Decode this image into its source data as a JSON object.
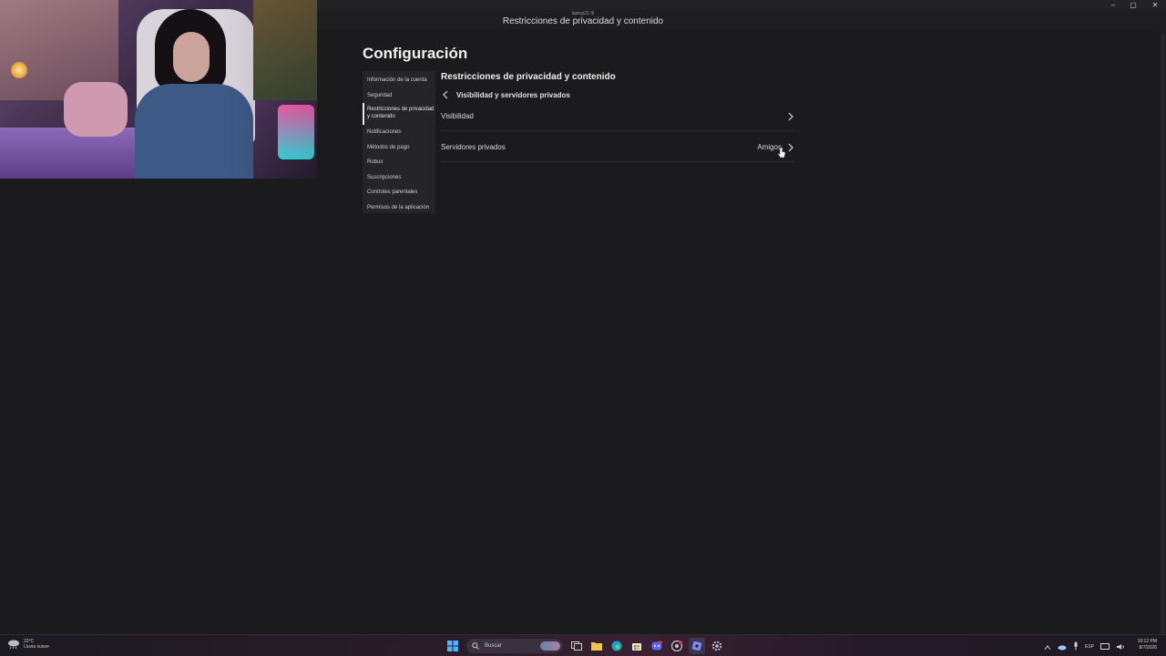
{
  "window": {
    "subtitle": "laptop21 III",
    "title": "Restricciones de privacidad y contenido",
    "controls": {
      "minimize": "–",
      "maximize": "▢",
      "close": "✕"
    }
  },
  "page": {
    "title": "Configuración"
  },
  "sidebar": {
    "items": [
      {
        "label": "Información de la cuenta"
      },
      {
        "label": "Seguridad"
      },
      {
        "label": "Restricciones de privacidad y contenido",
        "active": true
      },
      {
        "label": "Notificaciones"
      },
      {
        "label": "Métodos de pago"
      },
      {
        "label": "Robux"
      },
      {
        "label": "Suscripciones"
      },
      {
        "label": "Controles parentales"
      },
      {
        "label": "Permisos de la aplicación"
      }
    ]
  },
  "content": {
    "section_title": "Restricciones de privacidad y contenido",
    "back_label": "Visibilidad y servidores privados",
    "rows": [
      {
        "label": "Visibilidad",
        "value": ""
      },
      {
        "label": "Servidores privados",
        "value": "Amigos"
      }
    ]
  },
  "taskbar": {
    "weather": {
      "temp": "22°C",
      "condition": "Lluvia suave"
    },
    "search_placeholder": "Buscar",
    "apps": [
      "windows-start-icon",
      "search-icon",
      "task-view-icon",
      "file-explorer-icon",
      "edge-icon",
      "store-icon",
      "discord-icon",
      "chrome-icon",
      "roblox-icon",
      "settings-icon"
    ],
    "tray": {
      "language": "ESP"
    },
    "clock": {
      "time": "10:12 PM",
      "date": "8/7/2026"
    }
  },
  "colors": {
    "background": "#1b1b1d",
    "sidebar": "#252528",
    "text": "#e8e8e8",
    "accent_taskbar": "#3a2030"
  }
}
